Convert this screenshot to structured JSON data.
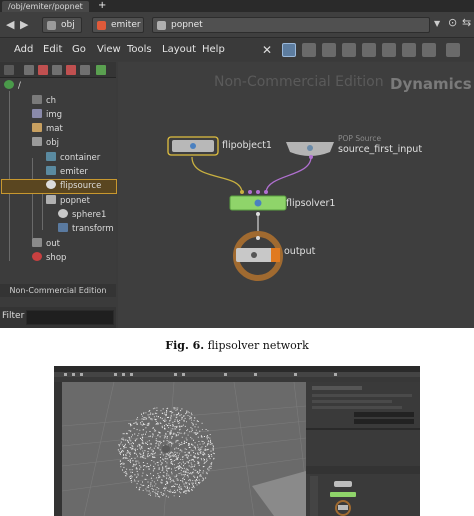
{
  "screenshot1": {
    "tab_title": "/obj/emiter/popnet",
    "tab_add": "+",
    "path": [
      {
        "label": "obj",
        "color": "#9a9a9a"
      },
      {
        "label": "emiter",
        "color": "#e05a3a"
      },
      {
        "label": "popnet",
        "color": "#b0b0b0"
      }
    ],
    "menu": [
      "Add",
      "Edit",
      "Go",
      "View",
      "Tools",
      "Layout",
      "Help"
    ],
    "tree": [
      {
        "label": "/"
      },
      {
        "label": "ch"
      },
      {
        "label": "img"
      },
      {
        "label": "mat"
      },
      {
        "label": "obj"
      },
      {
        "label": "container"
      },
      {
        "label": "emiter"
      },
      {
        "label": "flipsource"
      },
      {
        "label": "popnet"
      },
      {
        "label": "sphere1"
      },
      {
        "label": "transform"
      },
      {
        "label": "out"
      },
      {
        "label": "shop"
      }
    ],
    "left_watermark": "Non-Commercial Edition",
    "filter_label": "Filter",
    "network": {
      "watermark": "Non-Commercial Edition",
      "context_label": "Dynamics",
      "nodes": {
        "flipobject": "flipobject1",
        "source_type": "POP Source",
        "source": "source_first_input",
        "flipsolver": "flipsolver1",
        "output": "output"
      }
    }
  },
  "captions": {
    "fig_label": "Fig. 6.",
    "fig_text": " flipsolver network"
  },
  "colors": {
    "accent_select": "#c8982f",
    "flipsolver_green": "#8fd46a",
    "output_ring": "#a06a30",
    "connector_purple": "#b070d0"
  }
}
